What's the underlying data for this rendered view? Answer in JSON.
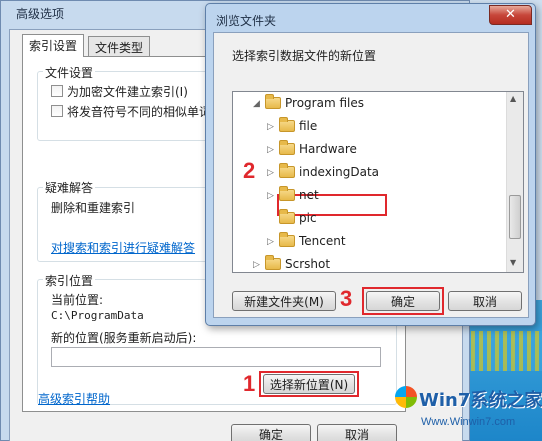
{
  "advanced_options": {
    "title": "高级选项",
    "tabs": [
      "索引设置",
      "文件类型"
    ],
    "file_settings": {
      "title": "文件设置",
      "encrypt_label": "为加密文件建立索引(I)",
      "diacritics_label": "将发音符号不同的相似单词"
    },
    "troubleshoot": {
      "title": "疑难解答",
      "rebuild_label": "删除和重建索引",
      "link_text": "对搜索和索引进行疑难解答"
    },
    "index_location": {
      "title": "索引位置",
      "current_label": "当前位置:",
      "current_value": "C:\\ProgramData",
      "new_label": "新的位置(服务重新启动后):",
      "new_value": "",
      "select_button": "选择新位置(N)"
    },
    "help_link": "高级索引帮助",
    "ok_button": "确定",
    "cancel_button": "取消"
  },
  "browse_dialog": {
    "title": "浏览文件夹",
    "close_glyph": "✕",
    "description": "选择索引数据文件的新位置",
    "tree": [
      {
        "label": "Program files",
        "expanded": true
      },
      {
        "label": "file",
        "expanded": false
      },
      {
        "label": "Hardware",
        "expanded": false
      },
      {
        "label": "indexingData",
        "expanded": false
      },
      {
        "label": "net",
        "expanded": false
      },
      {
        "label": "pic",
        "expanded": null
      },
      {
        "label": "Tencent",
        "expanded": false
      },
      {
        "label": "Scrshot",
        "expanded": false
      }
    ],
    "new_folder_button": "新建文件夹(M)",
    "ok_button": "确定",
    "cancel_button": "取消"
  },
  "annotations": {
    "step1": "1",
    "step2": "2",
    "step3": "3",
    "color": "#e0282d"
  },
  "watermark": {
    "brand": "Win7系统之家",
    "url": "Www.Winwin7.com"
  }
}
